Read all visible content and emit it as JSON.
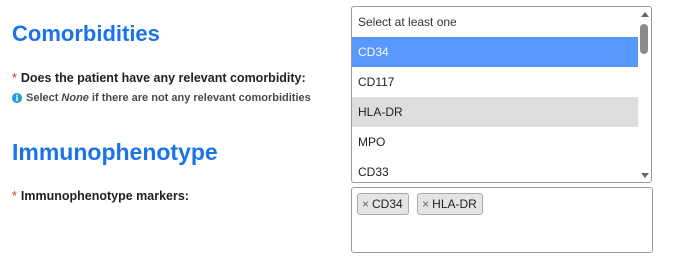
{
  "comorbidities": {
    "heading": "Comorbidities",
    "required_marker": "*",
    "question": "Does the patient have any relevant comorbidity:",
    "hint": {
      "icon": "info-icon",
      "prefix": "Select",
      "emphasis": "None",
      "suffix": "if there are not any relevant comorbidities"
    }
  },
  "immunophenotype": {
    "heading": "Immunophenotype",
    "required_marker": "*",
    "question": "Immunophenotype markers:",
    "selected": [
      {
        "remove": "×",
        "label": "CD34"
      },
      {
        "remove": "×",
        "label": "HLA-DR"
      }
    ]
  },
  "dropdown": {
    "placeholder": "Select at least one",
    "options": [
      {
        "label": "CD34",
        "state": "highlighted"
      },
      {
        "label": "CD117",
        "state": "normal"
      },
      {
        "label": "HLA-DR",
        "state": "selected"
      },
      {
        "label": "MPO",
        "state": "normal"
      },
      {
        "label": "CD33",
        "state": "normal"
      }
    ]
  },
  "colors": {
    "heading": "#1a73e8",
    "highlight": "#5897fb",
    "selected_row": "#dddddd",
    "required": "#d93025",
    "info": "#1a9bd7"
  }
}
